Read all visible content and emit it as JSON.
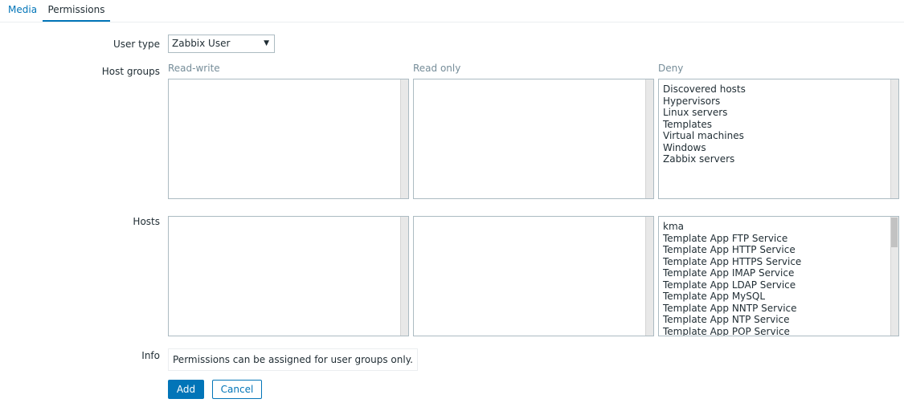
{
  "tabs": [
    {
      "label": "Media"
    },
    {
      "label": "Permissions"
    }
  ],
  "user_type": {
    "label": "User type",
    "value": "Zabbix User"
  },
  "host_groups": {
    "label": "Host groups",
    "columns": {
      "read_write": "Read-write",
      "read_only": "Read only",
      "deny": "Deny"
    },
    "deny_items": [
      "Discovered hosts",
      "Hypervisors",
      "Linux servers",
      "Templates",
      "Virtual machines",
      "Windows",
      "Zabbix servers"
    ]
  },
  "hosts": {
    "label": "Hosts",
    "deny_items": [
      "kma",
      "Template App FTP Service",
      "Template App HTTP Service",
      "Template App HTTPS Service",
      "Template App IMAP Service",
      "Template App LDAP Service",
      "Template App MySQL",
      "Template App NNTP Service",
      "Template App NTP Service",
      "Template App POP Service"
    ]
  },
  "info": {
    "label": "Info",
    "text": "Permissions can be assigned for user groups only."
  },
  "buttons": {
    "add": "Add",
    "cancel": "Cancel"
  },
  "colors": {
    "accent": "#0275b8",
    "muted_text": "#768d99"
  }
}
